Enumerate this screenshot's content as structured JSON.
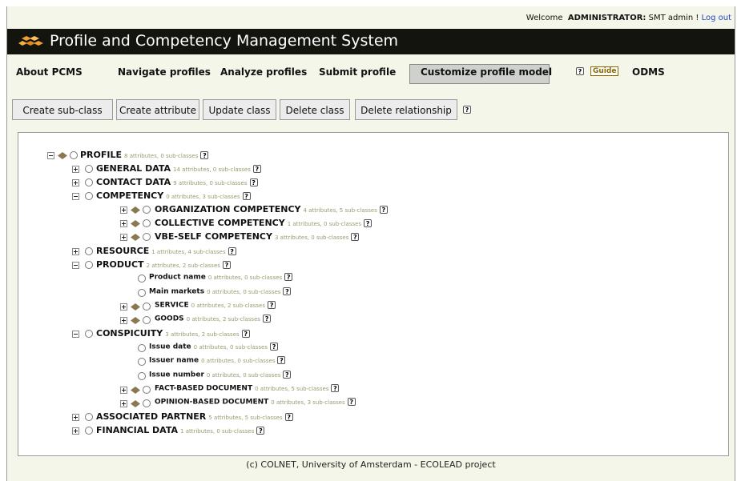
{
  "header": {
    "welcome": "Welcome",
    "user": "ADMINISTRATOR:",
    "user_name": "SMT admin !",
    "logout": "Log out",
    "title": "Profile and Competency Management System"
  },
  "menu": {
    "items": [
      "About PCMS",
      "Navigate profiles",
      "Analyze profiles",
      "Submit profile",
      "Customize profile model"
    ],
    "help": "?",
    "guide": "Guide",
    "odms": "ODMS"
  },
  "toolbar": {
    "buttons": [
      "Create sub-class",
      "Create attribute",
      "Update class",
      "Delete class",
      "Delete relationship"
    ],
    "help": "?"
  },
  "tree": {
    "nodes": [
      {
        "label": "PROFILE",
        "count": "8 attributes, 0 sub-classes"
      },
      {
        "label": "GENERAL DATA",
        "count": "14 attributes, 0 sub-classes"
      },
      {
        "label": "CONTACT DATA",
        "count": "9 attributes, 0 sub-classes"
      },
      {
        "label": "COMPETENCY",
        "count": "0 attributes, 3 sub-classes"
      },
      {
        "label": "ORGANIZATION COMPETENCY",
        "count": "4 attributes, 5 sub-classes"
      },
      {
        "label": "COLLECTIVE COMPETENCY",
        "count": "1 attributes, 0 sub-classes"
      },
      {
        "label": "VBE-SELF COMPETENCY",
        "count": "3 attributes, 0 sub-classes"
      },
      {
        "label": "RESOURCE",
        "count": "1 attributes, 4 sub-classes"
      },
      {
        "label": "PRODUCT",
        "count": "2 attributes, 2 sub-classes"
      },
      {
        "label": "Product name",
        "count": "0 attributes, 0 sub-classes"
      },
      {
        "label": "Main markets",
        "count": "0 attributes, 0 sub-classes"
      },
      {
        "label": "SERVICE",
        "count": "0 attributes, 2 sub-classes"
      },
      {
        "label": "GOODS",
        "count": "0 attributes, 2 sub-classes"
      },
      {
        "label": "CONSPICUITY",
        "count": "3 attributes, 2 sub-classes"
      },
      {
        "label": "Issue date",
        "count": "0 attributes, 0 sub-classes"
      },
      {
        "label": "Issuer name",
        "count": "0 attributes, 0 sub-classes"
      },
      {
        "label": "Issue number",
        "count": "0 attributes, 0 sub-classes"
      },
      {
        "label": "FACT-BASED DOCUMENT",
        "count": "0 attributes, 5 sub-classes"
      },
      {
        "label": "OPINION-BASED DOCUMENT",
        "count": "0 attributes, 3 sub-classes"
      },
      {
        "label": "ASSOCIATED PARTNER",
        "count": "5 attributes, 5 sub-classes"
      },
      {
        "label": "FINANCIAL DATA",
        "count": "1 attributes, 0 sub-classes"
      }
    ],
    "help": "?"
  },
  "footer": {
    "text": "(c) COLNET, University of Amsterdam - ECOLEAD project"
  },
  "colors": {
    "title_bar": "#14140f",
    "page_bg": "#f3f6e8",
    "diamond": "#8a7850",
    "logo": "#f0a030"
  }
}
